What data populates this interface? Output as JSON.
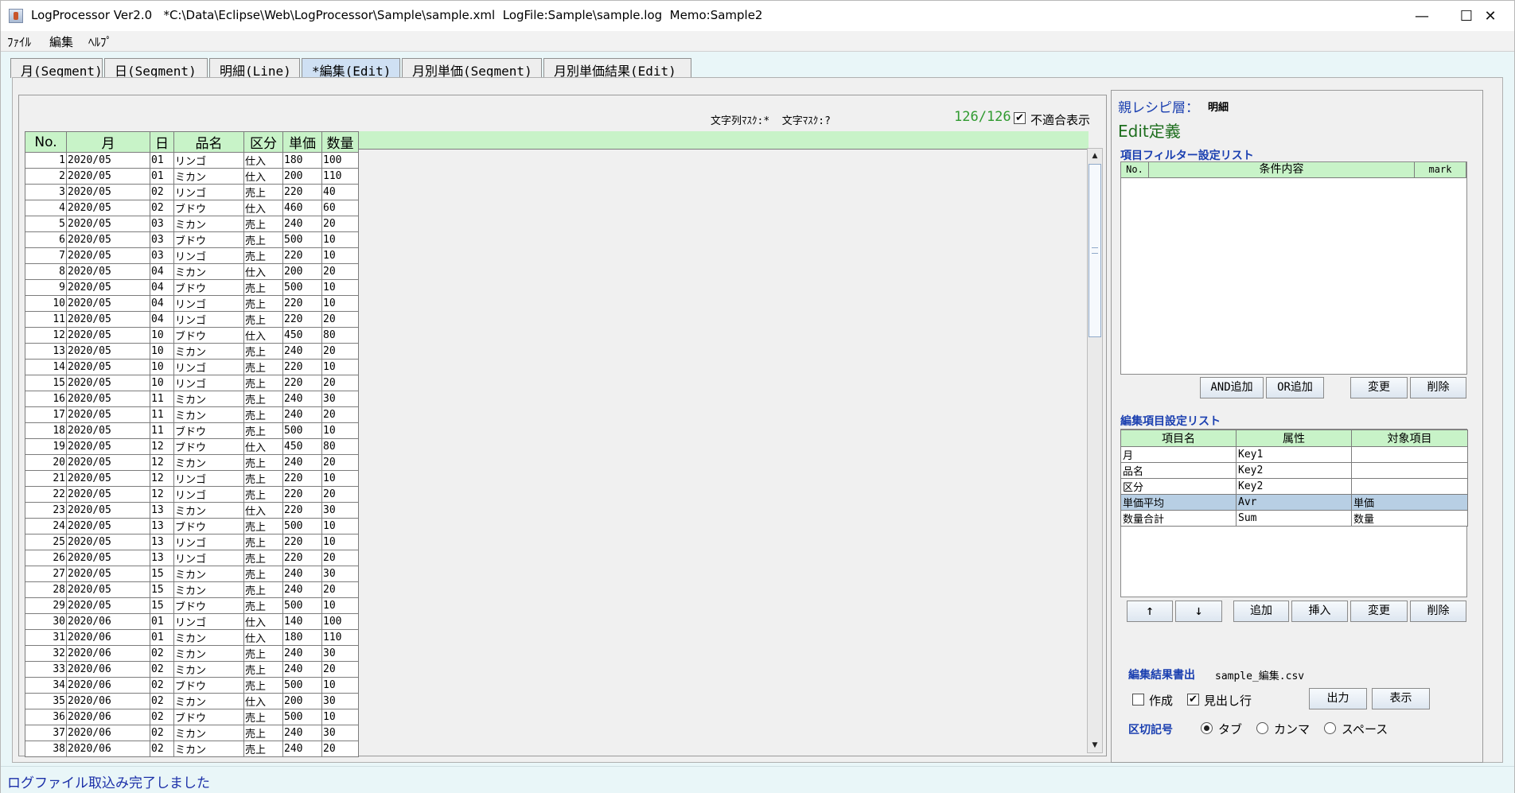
{
  "window": {
    "title": "LogProcessor Ver2.0   *C:\\Data\\Eclipse\\Web\\LogProcessor\\Sample\\sample.xml  LogFile:Sample\\sample.log  Memo:Sample2",
    "minimize_glyph": "—",
    "maximize_glyph": "☐",
    "close_glyph": "✕"
  },
  "menu": [
    "ﾌｧｲﾙ",
    "編集",
    "ﾍﾙﾌﾟ"
  ],
  "tabs": [
    {
      "label": "月(Segment)",
      "active": false
    },
    {
      "label": "日(Segment)",
      "active": false
    },
    {
      "label": "明細(Line)",
      "active": false
    },
    {
      "label": "*編集(Edit)",
      "active": true
    },
    {
      "label": "月別単価(Segment)",
      "active": false
    },
    {
      "label": "月別単価結果(Edit)",
      "active": false
    }
  ],
  "left": {
    "mask_label": "文字列ﾏｽｸ:*  文字ﾏｽｸ:?",
    "count": "126/126",
    "show_mismatch_label": "不適合表示",
    "show_mismatch_checked": true,
    "columns": [
      "No.",
      "月",
      "日",
      "品名",
      "区分",
      "単価",
      "数量"
    ],
    "rows": [
      [
        "1",
        "2020/05",
        "01",
        "リンゴ",
        "仕入",
        "180",
        "100"
      ],
      [
        "2",
        "2020/05",
        "01",
        "ミカン",
        "仕入",
        "200",
        "110"
      ],
      [
        "3",
        "2020/05",
        "02",
        "リンゴ",
        "売上",
        "220",
        "40"
      ],
      [
        "4",
        "2020/05",
        "02",
        "ブドウ",
        "仕入",
        "460",
        "60"
      ],
      [
        "5",
        "2020/05",
        "03",
        "ミカン",
        "売上",
        "240",
        "20"
      ],
      [
        "6",
        "2020/05",
        "03",
        "ブドウ",
        "売上",
        "500",
        "10"
      ],
      [
        "7",
        "2020/05",
        "03",
        "リンゴ",
        "売上",
        "220",
        "10"
      ],
      [
        "8",
        "2020/05",
        "04",
        "ミカン",
        "仕入",
        "200",
        "20"
      ],
      [
        "9",
        "2020/05",
        "04",
        "ブドウ",
        "売上",
        "500",
        "10"
      ],
      [
        "10",
        "2020/05",
        "04",
        "リンゴ",
        "売上",
        "220",
        "10"
      ],
      [
        "11",
        "2020/05",
        "04",
        "リンゴ",
        "売上",
        "220",
        "20"
      ],
      [
        "12",
        "2020/05",
        "10",
        "ブドウ",
        "仕入",
        "450",
        "80"
      ],
      [
        "13",
        "2020/05",
        "10",
        "ミカン",
        "売上",
        "240",
        "20"
      ],
      [
        "14",
        "2020/05",
        "10",
        "リンゴ",
        "売上",
        "220",
        "10"
      ],
      [
        "15",
        "2020/05",
        "10",
        "リンゴ",
        "売上",
        "220",
        "20"
      ],
      [
        "16",
        "2020/05",
        "11",
        "ミカン",
        "売上",
        "240",
        "30"
      ],
      [
        "17",
        "2020/05",
        "11",
        "ミカン",
        "売上",
        "240",
        "20"
      ],
      [
        "18",
        "2020/05",
        "11",
        "ブドウ",
        "売上",
        "500",
        "10"
      ],
      [
        "19",
        "2020/05",
        "12",
        "ブドウ",
        "仕入",
        "450",
        "80"
      ],
      [
        "20",
        "2020/05",
        "12",
        "ミカン",
        "売上",
        "240",
        "20"
      ],
      [
        "21",
        "2020/05",
        "12",
        "リンゴ",
        "売上",
        "220",
        "10"
      ],
      [
        "22",
        "2020/05",
        "12",
        "リンゴ",
        "売上",
        "220",
        "20"
      ],
      [
        "23",
        "2020/05",
        "13",
        "ミカン",
        "仕入",
        "220",
        "30"
      ],
      [
        "24",
        "2020/05",
        "13",
        "ブドウ",
        "売上",
        "500",
        "10"
      ],
      [
        "25",
        "2020/05",
        "13",
        "リンゴ",
        "売上",
        "220",
        "10"
      ],
      [
        "26",
        "2020/05",
        "13",
        "リンゴ",
        "売上",
        "220",
        "20"
      ],
      [
        "27",
        "2020/05",
        "15",
        "ミカン",
        "売上",
        "240",
        "30"
      ],
      [
        "28",
        "2020/05",
        "15",
        "ミカン",
        "売上",
        "240",
        "20"
      ],
      [
        "29",
        "2020/05",
        "15",
        "ブドウ",
        "売上",
        "500",
        "10"
      ],
      [
        "30",
        "2020/06",
        "01",
        "リンゴ",
        "仕入",
        "140",
        "100"
      ],
      [
        "31",
        "2020/06",
        "01",
        "ミカン",
        "仕入",
        "180",
        "110"
      ],
      [
        "32",
        "2020/06",
        "02",
        "ミカン",
        "売上",
        "240",
        "30"
      ],
      [
        "33",
        "2020/06",
        "02",
        "ミカン",
        "売上",
        "240",
        "20"
      ],
      [
        "34",
        "2020/06",
        "02",
        "ブドウ",
        "売上",
        "500",
        "10"
      ],
      [
        "35",
        "2020/06",
        "02",
        "ミカン",
        "仕入",
        "200",
        "30"
      ],
      [
        "36",
        "2020/06",
        "02",
        "ブドウ",
        "売上",
        "500",
        "10"
      ],
      [
        "37",
        "2020/06",
        "02",
        "ミカン",
        "売上",
        "240",
        "30"
      ],
      [
        "38",
        "2020/06",
        "02",
        "ミカン",
        "売上",
        "240",
        "20"
      ]
    ],
    "scroll_up": "▲",
    "scroll_down": "▼"
  },
  "right": {
    "parent_label": "親レシピ層：",
    "parent_value": "明細",
    "edit_title": "Edit定義",
    "filter_title": "項目フィルター設定リスト",
    "filter_columns": [
      "No.",
      "条件内容",
      "mark"
    ],
    "filter_buttons": [
      "AND追加",
      "OR追加",
      "変更",
      "削除"
    ],
    "edit_list_title": "編集項目設定リスト",
    "edit_columns": [
      "項目名",
      "属性",
      "対象項目"
    ],
    "edit_rows": [
      {
        "name": "月",
        "attr": "Key1",
        "target": "",
        "selected": false
      },
      {
        "name": "品名",
        "attr": "Key2",
        "target": "",
        "selected": false
      },
      {
        "name": "区分",
        "attr": "Key2",
        "target": "",
        "selected": false
      },
      {
        "name": "単価平均",
        "attr": "Avr",
        "target": "単価",
        "selected": true
      },
      {
        "name": "数量合計",
        "attr": "Sum",
        "target": "数量",
        "selected": false
      }
    ],
    "edit_buttons": [
      "↑",
      "↓",
      "追加",
      "挿入",
      "変更",
      "削除"
    ],
    "output_label": "編集結果書出",
    "output_file": "sample_編集.csv",
    "create_label": "作成",
    "create_checked": false,
    "header_row_label": "見出し行",
    "header_row_checked": true,
    "output_button": "出力",
    "show_button": "表示",
    "delimiter_label": "区切記号",
    "delimiters": [
      {
        "label": "タブ",
        "selected": true
      },
      {
        "label": "カンマ",
        "selected": false
      },
      {
        "label": "スペース",
        "selected": false
      }
    ]
  },
  "status": "ログファイル取込み完了しました",
  "colors": {
    "header_green": "#c8f3c8",
    "count_green": "#2f9a2f",
    "heading_blue": "#1a3fb0",
    "selected_row": "#b8cfe4"
  }
}
